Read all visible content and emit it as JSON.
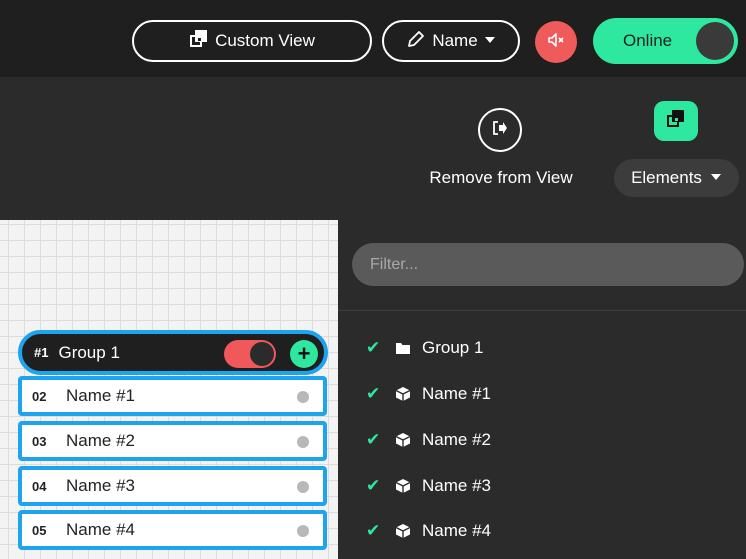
{
  "toolbar": {
    "custom_view_label": "Custom View",
    "name_label": "Name",
    "online_label": "Online"
  },
  "actions": {
    "remove_label": "Remove from View",
    "elements_label": "Elements"
  },
  "group": {
    "number": "#1",
    "name": "Group 1"
  },
  "rows": [
    {
      "num": "02",
      "name": "Name #1"
    },
    {
      "num": "03",
      "name": "Name #2"
    },
    {
      "num": "04",
      "name": "Name #3"
    },
    {
      "num": "05",
      "name": "Name #4"
    }
  ],
  "panel": {
    "filter_placeholder": "Filter...",
    "items": [
      {
        "label": "Group 1",
        "icon": "folder-icon"
      },
      {
        "label": "Name #1",
        "icon": "cube-icon"
      },
      {
        "label": "Name #2",
        "icon": "cube-icon"
      },
      {
        "label": "Name #3",
        "icon": "cube-icon"
      },
      {
        "label": "Name #4",
        "icon": "cube-icon"
      }
    ]
  },
  "colors": {
    "accent": "#2ee8a0",
    "selection": "#1ea3f0",
    "danger": "#ef5b5b"
  }
}
